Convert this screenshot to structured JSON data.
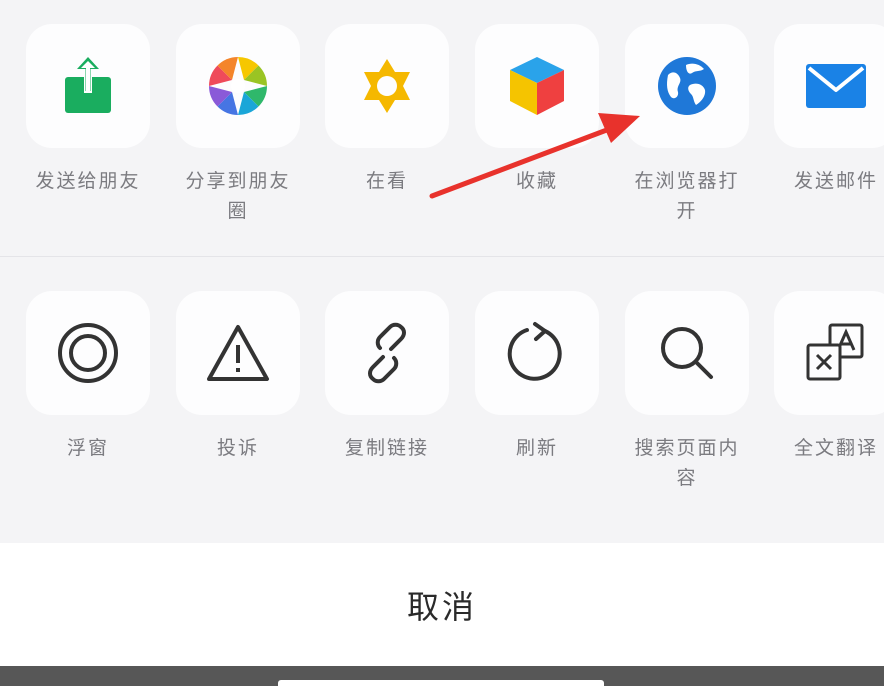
{
  "share_row": [
    {
      "label": "发送给朋友",
      "icon": "share-up-icon"
    },
    {
      "label": "分享到朋友圈",
      "icon": "moments-aperture-icon"
    },
    {
      "label": "在看",
      "icon": "wow-star-icon"
    },
    {
      "label": "收藏",
      "icon": "favorites-cube-icon"
    },
    {
      "label": "在浏览器打开",
      "icon": "globe-icon"
    },
    {
      "label": "发送邮件",
      "icon": "mail-icon"
    }
  ],
  "action_row": [
    {
      "label": "浮窗",
      "icon": "float-window-icon"
    },
    {
      "label": "投诉",
      "icon": "warning-icon"
    },
    {
      "label": "复制链接",
      "icon": "link-icon"
    },
    {
      "label": "刷新",
      "icon": "refresh-icon"
    },
    {
      "label": "搜索页面内容",
      "icon": "search-icon"
    },
    {
      "label": "全文翻译",
      "icon": "translate-icon"
    }
  ],
  "cancel_label": "取消",
  "colors": {
    "sheet_background": "#f4f4f6",
    "tile_background": "#fdfdfe",
    "label_text": "#7b7b80",
    "share_green": "#1aad5f",
    "globe_blue": "#1f78d8",
    "mail_blue": "#1a82e6",
    "wow_yellow": "#f5b800",
    "annotation_arrow": "#e8322c"
  }
}
